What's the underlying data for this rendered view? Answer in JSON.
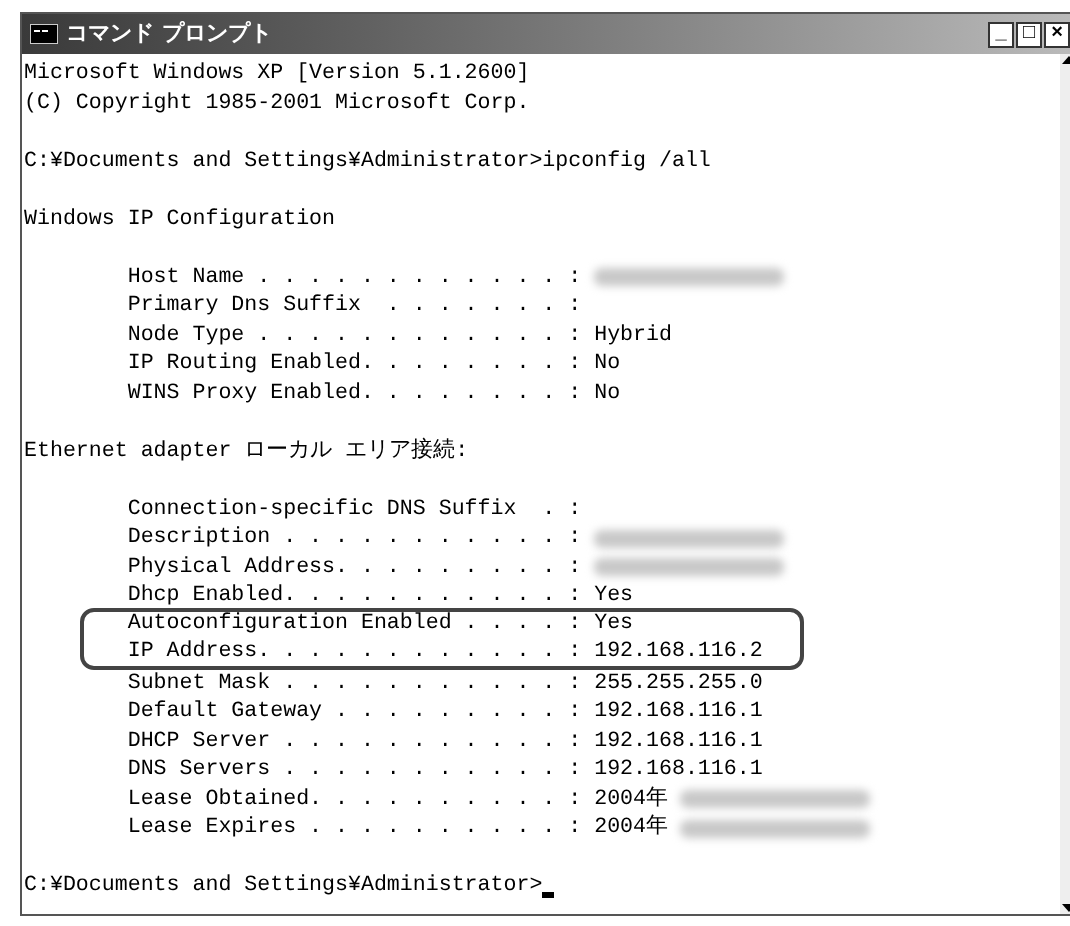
{
  "window": {
    "title": "コマンド プロンプト",
    "buttons": [
      "_",
      "□",
      "×"
    ]
  },
  "console": {
    "lines": [
      {
        "kind": "text",
        "text": "Microsoft Windows XP [Version 5.1.2600]"
      },
      {
        "kind": "text",
        "text": "(C) Copyright 1985-2001 Microsoft Corp."
      },
      {
        "kind": "blank"
      },
      {
        "kind": "text",
        "text": "C:¥Documents and Settings¥Administrator>ipconfig /all"
      },
      {
        "kind": "blank"
      },
      {
        "kind": "text",
        "text": "Windows IP Configuration"
      },
      {
        "kind": "blank"
      },
      {
        "kind": "text",
        "text": "        Host Name . . . . . . . . . . . . :",
        "redacted": true
      },
      {
        "kind": "text",
        "text": "        Primary Dns Suffix  . . . . . . . :"
      },
      {
        "kind": "text",
        "text": "        Node Type . . . . . . . . . . . . : Hybrid"
      },
      {
        "kind": "text",
        "text": "        IP Routing Enabled. . . . . . . . : No"
      },
      {
        "kind": "text",
        "text": "        WINS Proxy Enabled. . . . . . . . : No"
      },
      {
        "kind": "blank"
      },
      {
        "kind": "text",
        "text": "Ethernet adapter ローカル エリア接続:"
      },
      {
        "kind": "blank"
      },
      {
        "kind": "text",
        "text": "        Connection-specific DNS Suffix  . :"
      },
      {
        "kind": "text",
        "text": "        Description . . . . . . . . . . . :",
        "redacted": true
      },
      {
        "kind": "text",
        "text": "        Physical Address. . . . . . . . . :",
        "redacted": true
      },
      {
        "kind": "text",
        "text": "        Dhcp Enabled. . . . . . . . . . . : Yes"
      },
      {
        "kind": "text",
        "text": "        Autoconfiguration Enabled . . . . : Yes",
        "highlighted": true
      },
      {
        "kind": "text",
        "text": "        IP Address. . . . . . . . . . . . : 192.168.116.2",
        "highlighted": true
      },
      {
        "kind": "text",
        "text": "        Subnet Mask . . . . . . . . . . . : 255.255.255.0"
      },
      {
        "kind": "text",
        "text": "        Default Gateway . . . . . . . . . : 192.168.116.1"
      },
      {
        "kind": "text",
        "text": "        DHCP Server . . . . . . . . . . . : 192.168.116.1"
      },
      {
        "kind": "text",
        "text": "        DNS Servers . . . . . . . . . . . : 192.168.116.1"
      },
      {
        "kind": "text",
        "text": "        Lease Obtained. . . . . . . . . . : 2004年",
        "redacted": true
      },
      {
        "kind": "text",
        "text": "        Lease Expires . . . . . . . . . . : 2004年",
        "redacted": true
      },
      {
        "kind": "blank"
      },
      {
        "kind": "prompt",
        "text": "C:¥Documents and Settings¥Administrator>"
      }
    ]
  }
}
